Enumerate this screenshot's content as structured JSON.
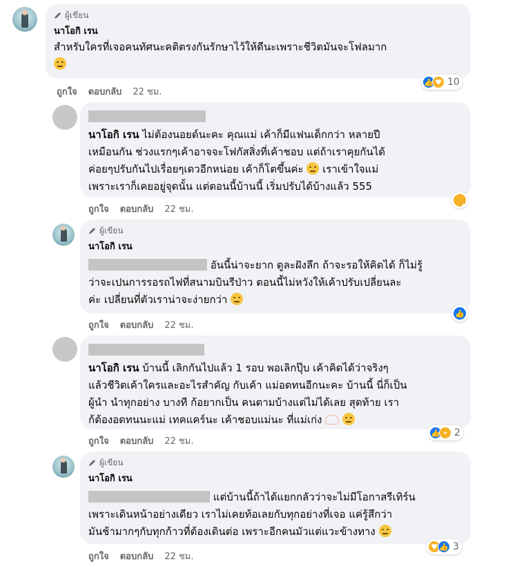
{
  "author_badge": "ผู้เขียน",
  "actions": {
    "like": "ถูกใจ",
    "reply": "ตอบกลับ"
  },
  "comments": [
    {
      "name": "นาโอกิ เรน",
      "line1": "สำหรับใครที่เจอคนทัศนะคติตรงกันรักษาไว้ให้ดีนะเพราะชีวิตมันจะโฟลมาก",
      "time": "22 ชม.",
      "reaction_count": "10"
    },
    {
      "name": "นาโอกิ เรน",
      "line1": "ไม่ต้องนอยด์นะคะ คุณแม่ เค้าก็มีแฟนเด็กกว่า หลายปี",
      "line2": "เหมือนกัน ช่วงแรกๆเค้าอาจจะโฟกัสสิ่งที่เค้าชอบ แต่ถ้าเราคุยกันได้",
      "line3": "ค่อยๆปรับกันไปเรื่อยๆเดวอีกหน่อย เค้าก็โตขึ้นค่ะ",
      "line3b": "เราเข้าใจแม่",
      "line4": "เพราะเราก็เคยอยู่จุดนั้น แต่ตอนนี้บ้านนี้ เริ่มปรับได้บ้างแล้ว 555",
      "time": "22 ชม."
    },
    {
      "name": "นาโอกิ เรน",
      "line1": "อันนี้น่าจะยาก ดูละฝังลึก ถ้าจะรอให้คิดได้ ก็ไม่รู้",
      "line2": "ว่าจะเปนการรอรถไฟที่สนามบินรีป่าว ตอนนี้ไม่หวังให้เค้าปรับเปลี่ยนละ",
      "line3": "ค่ะ เปลี่ยนที่ตัวเราน่าจะง่ายกว่า",
      "time": "22 ชม."
    },
    {
      "name": "นาโอกิ เรน",
      "line1": "บ้านนี้ เลิกกันไปแล้ว 1 รอบ พอเลิกปุ๊บ เค้าคิดได้ว่าจริงๆ",
      "line2": "แล้วชีวิตเค้าใครและอะไรสำคัญ กับเค้า แม่อดทนอีกนะคะ บ้านนี้ นี่ก็เป็น",
      "line3": "ผู้นำ นำทุกอย่าง บางที ก้อยากเป็น คนตามบ้างแต่ไม่ได้เลย สุดท้าย เรา",
      "line4": "ก้ต้องอดทนนะแม่ เทคแคร์นะ เค้าชอบแม่นะ ที่แม่เก่ง",
      "time": "22 ชม.",
      "reaction_count": "2"
    },
    {
      "name": "นาโอกิ เรน",
      "line1": "แต่บ้านนี้ถ้าได้แยกกลัวว่าจะไม่มีโอกาสรีเทิร์น",
      "line2": "เพราะเดินหน้าอย่างเดียว เราไม่เคยท้อเลยกับทุกอย่างที่เจอ แค่รู้สึกว่า",
      "line3": "มันช้ามากๆกับทุกก้าวที่ต้องเดินต่อ เพราะอีกคนมัวแต่แวะข้างทาง",
      "time": "22 ชม.",
      "reaction_count": "3"
    }
  ]
}
